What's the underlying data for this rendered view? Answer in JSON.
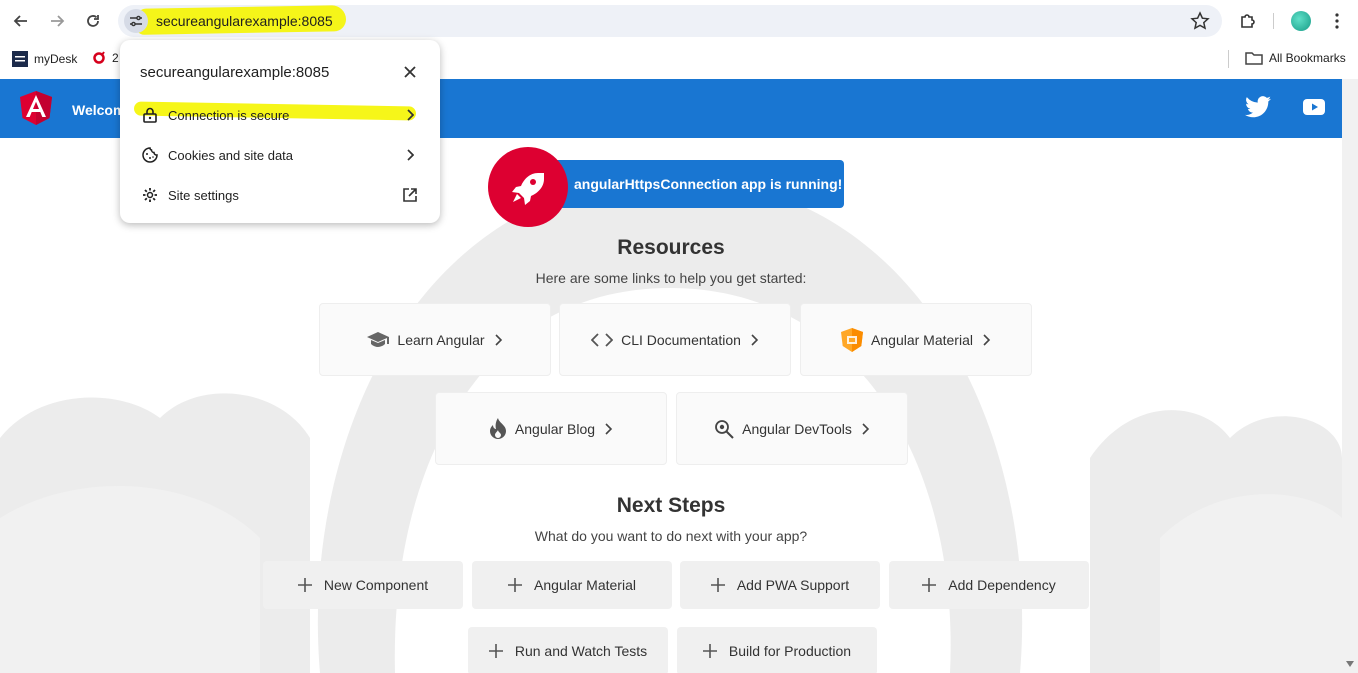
{
  "browser": {
    "url": "secureangularexample:8085",
    "bookmarks": [
      {
        "label": "myDesk"
      },
      {
        "label": "2"
      }
    ],
    "all_bookmarks": "All Bookmarks"
  },
  "popup": {
    "title": "secureangularexample:8085",
    "rows": [
      {
        "label": "Connection is secure",
        "icon": "lock-icon"
      },
      {
        "label": "Cookies and site data",
        "icon": "cookie-icon"
      },
      {
        "label": "Site settings",
        "icon": "gear-icon"
      }
    ]
  },
  "app": {
    "welcome": "Welcom",
    "running": "angularHttpsConnection app is running!",
    "resources_title": "Resources",
    "resources_subtitle": "Here are some links to help you get started:",
    "resources": [
      {
        "label": "Learn Angular",
        "icon": "graduation-cap-icon"
      },
      {
        "label": "CLI Documentation",
        "icon": "code-icon"
      },
      {
        "label": "Angular Material",
        "icon": "material-shield-icon"
      },
      {
        "label": "Angular Blog",
        "icon": "flame-icon"
      },
      {
        "label": "Angular DevTools",
        "icon": "devtools-search-icon"
      }
    ],
    "next_title": "Next Steps",
    "next_subtitle": "What do you want to do next with your app?",
    "steps": [
      {
        "label": "New Component"
      },
      {
        "label": "Angular Material"
      },
      {
        "label": "Add PWA Support"
      },
      {
        "label": "Add Dependency"
      },
      {
        "label": "Run and Watch Tests"
      },
      {
        "label": "Build for Production"
      }
    ]
  },
  "colors": {
    "toolbar_blue": "#1976d2",
    "angular_red": "#dd0031",
    "highlight_yellow": "#f5f500"
  }
}
